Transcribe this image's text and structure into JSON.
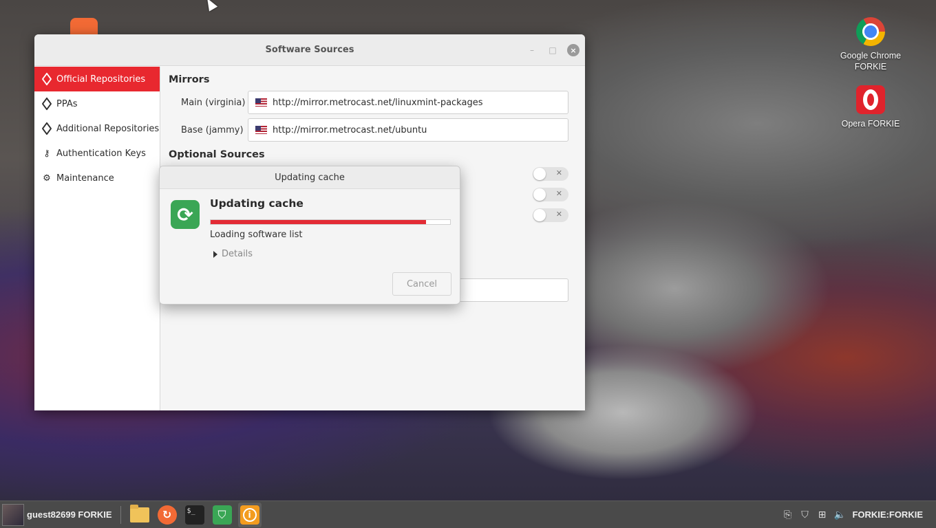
{
  "desktop": {
    "icons": [
      {
        "label_line1": "Google Chrome",
        "label_line2": "FORKIE"
      },
      {
        "label_line1": "Opera FORKIE"
      }
    ]
  },
  "window": {
    "title": "Software Sources",
    "sidebar": [
      {
        "label": "Official Repositories",
        "icon": "package-icon",
        "active": true
      },
      {
        "label": "PPAs",
        "icon": "package-icon"
      },
      {
        "label": "Additional Repositories",
        "icon": "package-icon"
      },
      {
        "label": "Authentication Keys",
        "icon": "key-icon"
      },
      {
        "label": "Maintenance",
        "icon": "gear-icon"
      }
    ],
    "mirrors": {
      "title": "Mirrors",
      "main_label": "Main (virginia)",
      "main_url": "http://mirror.metrocast.net/linuxmint-packages",
      "base_label": "Base (jammy)",
      "base_url": "http://mirror.metrocast.net/ubuntu"
    },
    "optional": {
      "title": "Optional Sources",
      "toggles": [
        false,
        false,
        false
      ]
    }
  },
  "dialog": {
    "title": "Updating cache",
    "heading": "Updating cache",
    "progress": 0.9,
    "status": "Loading software list",
    "details_label": "Details",
    "cancel_label": "Cancel",
    "accent": "#e32b35"
  },
  "taskbar": {
    "user": "guest82699 FORKIE",
    "hostname": "FORKIE:FORKIE"
  }
}
